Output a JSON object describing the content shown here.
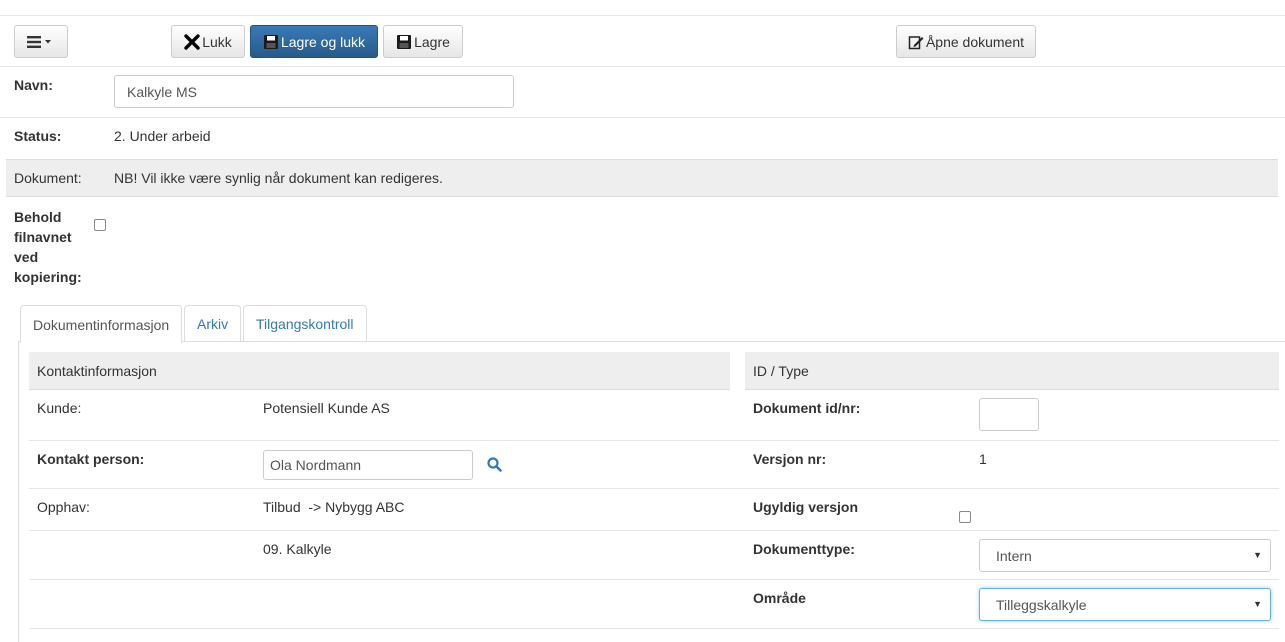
{
  "toolbar": {
    "menu_icon": "hamburger-menu-icon",
    "close_label": "Lukk",
    "save_close_label": "Lagre og lukk",
    "save_label": "Lagre",
    "open_doc_label": "Åpne dokument"
  },
  "form": {
    "name_label": "Navn:",
    "name_value": "Kalkyle MS",
    "status_label": "Status:",
    "status_value": "2. Under arbeid",
    "document_label": "Dokument:",
    "document_note": "NB! Vil ikke være synlig når dokument kan redigeres.",
    "keep_filename_label": [
      "Behold",
      "filnavnet",
      "ved",
      "kopiering:"
    ],
    "keep_filename_checked": false
  },
  "tabs": [
    {
      "label": "Dokumentinformasjon",
      "active": true
    },
    {
      "label": "Arkiv",
      "active": false
    },
    {
      "label": "Tilgangskontroll",
      "active": false
    }
  ],
  "contact": {
    "heading": "Kontaktinformasjon",
    "customer_label": "Kunde:",
    "customer_value": "Potensiell Kunde AS",
    "contact_label": "Kontakt person:",
    "contact_value": "Ola Nordmann",
    "origin_label": "Opphav:",
    "origin_value": "Tilbud  -> Nybygg ABC",
    "origin_sub": "09. Kalkyle"
  },
  "idtype": {
    "heading": "ID / Type",
    "docid_label": "Dokument id/nr:",
    "docid_value": "",
    "version_label": "Versjon nr:",
    "version_value": "1",
    "invalid_label": "Ugyldig versjon",
    "invalid_checked": false,
    "doctype_label": "Dokumenttype:",
    "doctype_value": "Intern",
    "area_label": "Område",
    "area_value": "Tilleggskalkyle"
  },
  "colors": {
    "primary": "#2d6ca2",
    "link": "#337ab7",
    "section_bg": "#eeeeee"
  }
}
